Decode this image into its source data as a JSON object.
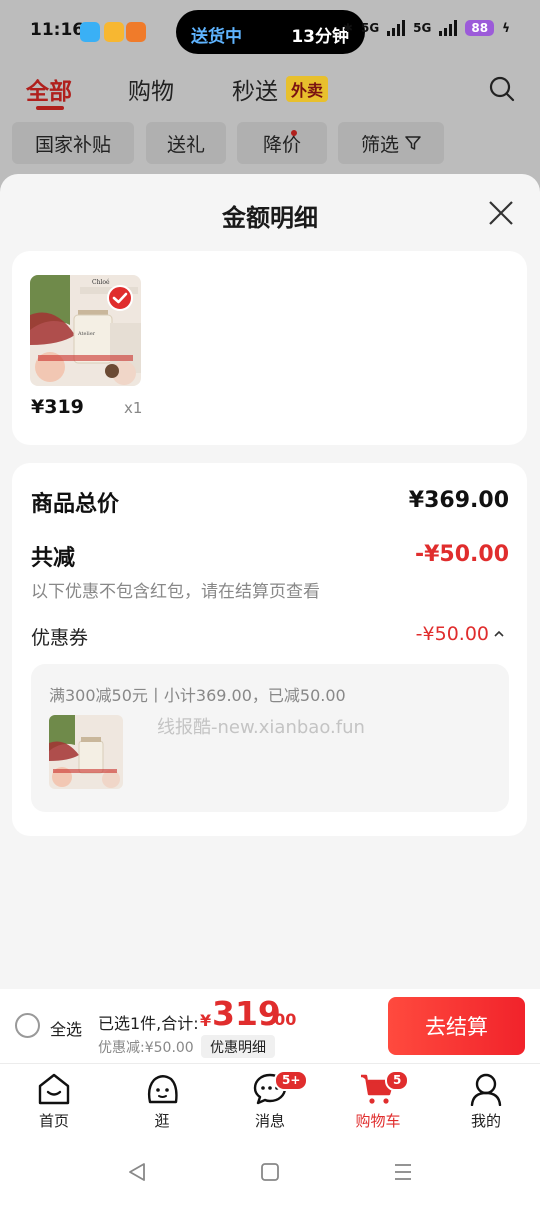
{
  "status_bar": {
    "time": "11:16",
    "pill_left": "送货中",
    "pill_right": "13分钟",
    "network": "5G",
    "battery": "88"
  },
  "top_tabs": [
    {
      "label": "全部",
      "active": true
    },
    {
      "label": "购物",
      "active": false
    },
    {
      "label": "秒送",
      "active": false
    }
  ],
  "waimai_badge": "外卖",
  "filters": [
    {
      "label": "国家补贴"
    },
    {
      "label": "送礼"
    },
    {
      "label": "降价"
    },
    {
      "label": "筛选"
    }
  ],
  "sheet": {
    "title": "金额明细",
    "product": {
      "price": "¥319",
      "qty": "x1",
      "brand": "Chloé",
      "image_caption": "木兰诗语淡香水 50ml"
    },
    "summary": {
      "total_label": "商品总价",
      "total_value": "¥369.00",
      "reduction_label": "共减",
      "reduction_value": "-¥50.00",
      "note": "以下优惠不包含红包，请在结算页查看",
      "coupon_label": "优惠券",
      "coupon_value": "-¥50.00",
      "coupon_desc": "满300减50元丨小计369.00，已减50.00"
    },
    "watermark": "线报酷-new.xianbao.fun"
  },
  "checkout": {
    "select_all": "全选",
    "selected_text": "已选1件,合计:",
    "currency": "¥",
    "total_int": "319",
    "total_dec": ".00",
    "discount": "优惠减:¥50.00",
    "detail_button": "优惠明细",
    "checkout_button": "去结算"
  },
  "bottom_nav": [
    {
      "label": "首页",
      "icon": "home-icon"
    },
    {
      "label": "逛",
      "icon": "browse-icon"
    },
    {
      "label": "消息",
      "icon": "message-icon",
      "badge": "5+"
    },
    {
      "label": "购物车",
      "icon": "cart-icon",
      "badge": "5",
      "active": true
    },
    {
      "label": "我的",
      "icon": "profile-icon"
    }
  ],
  "colors": {
    "accent_red": "#e02d2d",
    "tab_red": "#b0201d",
    "checkout_gradient_start": "#ff4a3e",
    "checkout_gradient_end": "#f1232b"
  }
}
